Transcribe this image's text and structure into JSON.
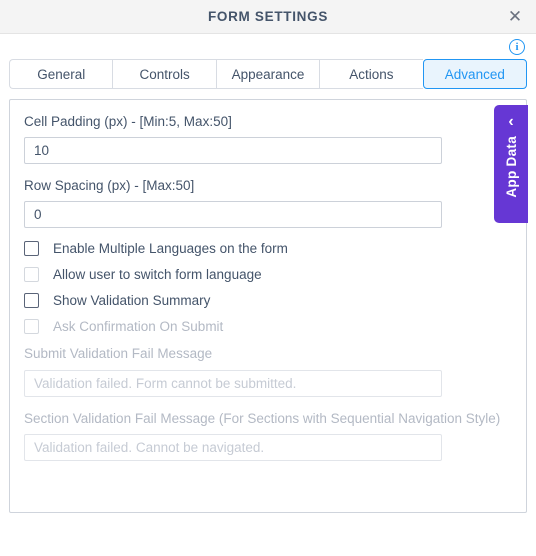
{
  "dialog": {
    "title": "FORM SETTINGS",
    "close_icon": "close-icon"
  },
  "info": {
    "icon": "info-icon",
    "glyph": "i"
  },
  "tabs": [
    {
      "label": "General",
      "selected": false
    },
    {
      "label": "Controls",
      "selected": false
    },
    {
      "label": "Appearance",
      "selected": false
    },
    {
      "label": "Actions",
      "selected": false
    },
    {
      "label": "Advanced",
      "selected": true
    }
  ],
  "colors": {
    "accent_blue": "#2196f3",
    "selected_tab_bg": "#e9f4fd",
    "app_data_purple": "#6637d4",
    "titlebar_bg": "#f4f4f4",
    "text": "#44546a",
    "disabled_text": "#b3b9c4"
  },
  "form": {
    "cell_padding": {
      "label": "Cell Padding (px) - [Min:5, Max:50]",
      "value": "10"
    },
    "row_spacing": {
      "label": "Row Spacing (px) - [Max:50]",
      "value": "0"
    },
    "checkboxes": [
      {
        "label": "Enable Multiple Languages on the form",
        "checked": false,
        "disabled": false
      },
      {
        "label": "Allow user to switch form language",
        "checked": false,
        "disabled": true
      },
      {
        "label": "Show Validation Summary",
        "checked": false,
        "disabled": false
      },
      {
        "label": "Ask Confirmation On Submit",
        "checked": false,
        "disabled": true
      }
    ],
    "submit_validation": {
      "label": "Submit Validation Fail Message",
      "placeholder": "Validation failed. Form cannot be submitted.",
      "value": ""
    },
    "section_validation": {
      "label": "Section Validation Fail Message (For Sections with Sequential Navigation Style)",
      "placeholder": "Validation failed. Cannot be navigated.",
      "value": ""
    }
  },
  "app_data": {
    "label": "App Data",
    "chevron": "‹"
  }
}
